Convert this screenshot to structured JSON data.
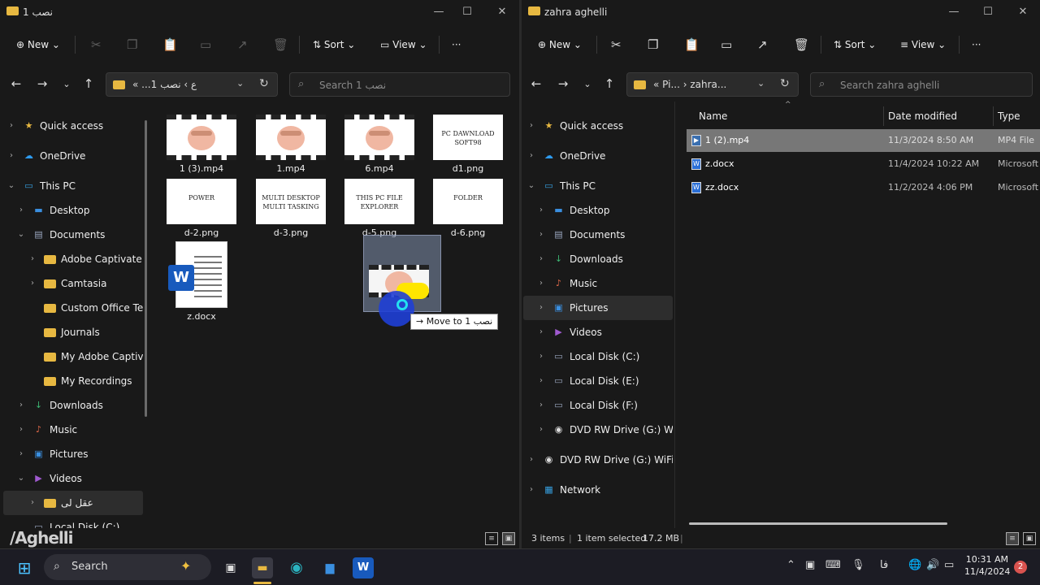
{
  "left_window": {
    "title": "نصب 1",
    "toolbar": {
      "new": "New",
      "sort": "Sort",
      "view": "View",
      "more": "···"
    },
    "address": {
      "prefix": "«",
      "path_a": "...ع",
      "path_b": "نصب 1"
    },
    "search_placeholder": "Search نصب 1",
    "nav": [
      "Quick access",
      "OneDrive",
      "This PC",
      "Desktop",
      "Documents",
      "Adobe Captivate Cach",
      "Camtasia",
      "Custom Office Templa",
      "Journals",
      "My Adobe Captivate F",
      "My Recordings",
      "Downloads",
      "Music",
      "Pictures",
      "Videos",
      "عقل لی",
      "Local Disk (C:)"
    ],
    "files": [
      {
        "name": "1 (3).mp4",
        "kind": "video"
      },
      {
        "name": "1.mp4",
        "kind": "video"
      },
      {
        "name": "6.mp4",
        "kind": "video"
      },
      {
        "name": "d1.png",
        "kind": "image",
        "label": "PC DAWNLOAD SOFT98"
      },
      {
        "name": "d-2.png",
        "kind": "image",
        "label": "POWER"
      },
      {
        "name": "d-3.png",
        "kind": "image",
        "label": "MULTI DESKTOP MULTI TASKING"
      },
      {
        "name": "d-5.png",
        "kind": "image",
        "label": "THIS PC FILE EXPLORER"
      },
      {
        "name": "d-6.png",
        "kind": "image",
        "label": "FOLDER"
      },
      {
        "name": "z.docx",
        "kind": "doc"
      }
    ],
    "drag_tooltip": "Move to نصب 1",
    "watermark": "/Aghelli"
  },
  "right_window": {
    "title": "zahra aghelli",
    "toolbar": {
      "new": "New",
      "sort": "Sort",
      "view": "View",
      "more": "···"
    },
    "address": {
      "prefix": "«",
      "path_a": "Pi...",
      "path_b": "zahra..."
    },
    "search_placeholder": "Search zahra aghelli",
    "nav": [
      "Quick access",
      "OneDrive",
      "This PC",
      "Desktop",
      "Documents",
      "Downloads",
      "Music",
      "Pictures",
      "Videos",
      "Local Disk (C:)",
      "Local Disk (E:)",
      "Local Disk (F:)",
      "DVD RW Drive (G:) WiFi Dri",
      "DVD RW Drive (G:) WiFi Drive",
      "Network"
    ],
    "columns": {
      "name": "Name",
      "date": "Date modified",
      "type": "Type"
    },
    "rows": [
      {
        "name": "1 (2).mp4",
        "date": "11/3/2024 8:50 AM",
        "type": "MP4 File",
        "selected": true
      },
      {
        "name": "z.docx",
        "date": "11/4/2024 10:22 AM",
        "type": "Microsoft W",
        "selected": false
      },
      {
        "name": "zz.docx",
        "date": "11/2/2024 4:06 PM",
        "type": "Microsoft W",
        "selected": false
      }
    ],
    "status": {
      "items": "3 items",
      "selected": "1 item selected",
      "size": "17.2 MB"
    }
  },
  "taskbar": {
    "search": "Search",
    "time": "10:31 AM",
    "date": "11/4/2024",
    "lang": "فا",
    "badge": "2"
  },
  "colors": {
    "folder": "#e7b841",
    "accent": "#185abd",
    "window_bg": "#191919"
  }
}
